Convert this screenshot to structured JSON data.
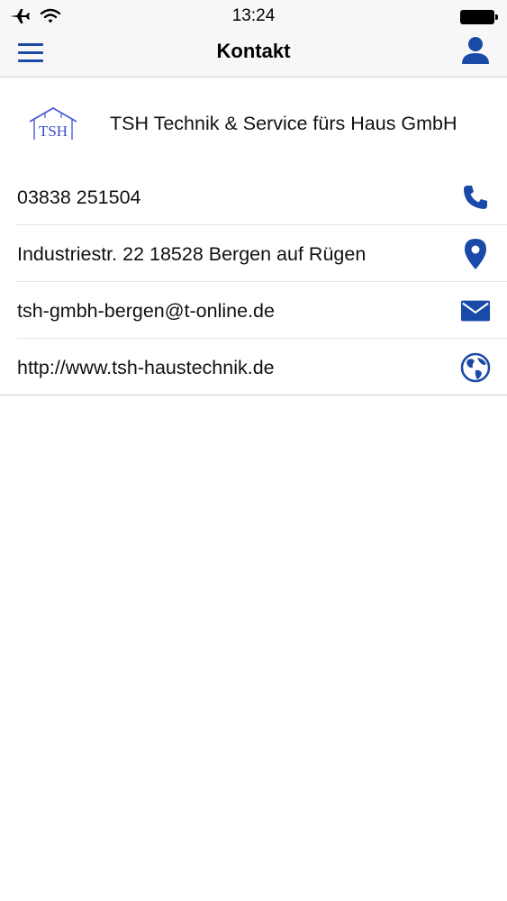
{
  "status_bar": {
    "time": "13:24",
    "icons": [
      "airplane-icon",
      "wifi-icon",
      "battery-icon"
    ]
  },
  "nav": {
    "title": "Kontakt",
    "left_icon": "menu-icon",
    "right_icon": "user-icon"
  },
  "company": {
    "logo_text": "TSH",
    "name": "TSH Technik & Service fürs Haus GmbH"
  },
  "contacts": [
    {
      "text": "03838 251504",
      "icon": "phone-icon"
    },
    {
      "text": "Industriestr. 22 18528 Bergen auf Rügen",
      "icon": "location-pin-icon"
    },
    {
      "text": "tsh-gmbh-bergen@t-online.de",
      "icon": "mail-icon"
    },
    {
      "text": "http://www.tsh-haustechnik.de",
      "icon": "globe-icon"
    }
  ],
  "colors": {
    "accent": "#1a4aa8",
    "bar_background": "#f7f7f7"
  }
}
